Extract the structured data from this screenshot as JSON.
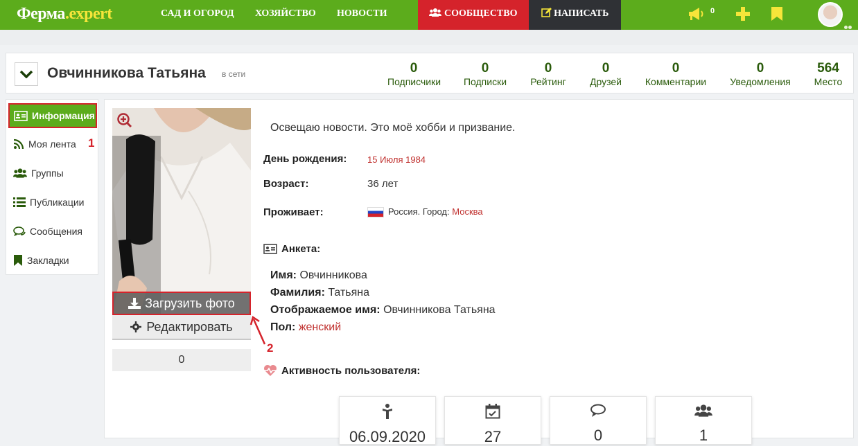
{
  "topbar": {
    "logo_main": "Ферма",
    "logo_dot": ".",
    "logo_sub": "expert",
    "nav": [
      "САД И ОГОРОД",
      "ХОЗЯЙСТВО",
      "НОВОСТИ"
    ],
    "community_label": "СООБЩЕСТВО",
    "write_label": "НАПИСАТЬ",
    "notifications_count": "0"
  },
  "header": {
    "user_name": "Овчинникова Татьяна",
    "status": "в сети",
    "stats": [
      {
        "value": "0",
        "label": "Подписчики"
      },
      {
        "value": "0",
        "label": "Подписки"
      },
      {
        "value": "0",
        "label": "Рейтинг"
      },
      {
        "value": "0",
        "label": "Друзей"
      },
      {
        "value": "0",
        "label": "Комментарии"
      },
      {
        "value": "0",
        "label": "Уведомления"
      },
      {
        "value": "564",
        "label": "Место"
      }
    ]
  },
  "sidebar": {
    "items": [
      {
        "label": "Информация",
        "icon": "id-card-icon"
      },
      {
        "label": "Моя лента",
        "icon": "rss-icon"
      },
      {
        "label": "Группы",
        "icon": "users-icon"
      },
      {
        "label": "Публикации",
        "icon": "list-icon"
      },
      {
        "label": "Сообщения",
        "icon": "comments-icon"
      },
      {
        "label": "Закладки",
        "icon": "bookmark-icon"
      }
    ],
    "annotation_1": "1"
  },
  "profile": {
    "upload_label": "Загрузить фото",
    "edit_label": "Редактировать",
    "photo_counter": "0",
    "annotation_2": "2",
    "about": "Освещаю новости. Это моё хобби и призвание.",
    "birthday_label": "День рождения:",
    "birthday_value": "15 Июля 1984",
    "age_label": "Возраст:",
    "age_value": "36 лет",
    "lives_label": "Проживает:",
    "lives_prefix": "Россия. Город:",
    "lives_city": "Москва",
    "anketa_title": "Анкета:",
    "first_name_label": "Имя:",
    "first_name": "Овчинникова",
    "last_name_label": "Фамилия:",
    "last_name": "Татьяна",
    "display_name_label": "Отображаемое имя:",
    "display_name": "Овчинникова Татьяна",
    "gender_label": "Пол:",
    "gender": "женский",
    "activity_title": "Активность пользователя:"
  },
  "activity": [
    {
      "icon": "person-icon",
      "value": "06.09.2020"
    },
    {
      "icon": "calendar-check-icon",
      "value": "27"
    },
    {
      "icon": "comment-icon",
      "value": "0"
    },
    {
      "icon": "users-icon",
      "value": "1"
    }
  ],
  "colors": {
    "brand_green": "#5cac1c",
    "accent_red": "#d5232b",
    "dark": "#2f3135",
    "logo_yellow": "#f6e53a"
  }
}
